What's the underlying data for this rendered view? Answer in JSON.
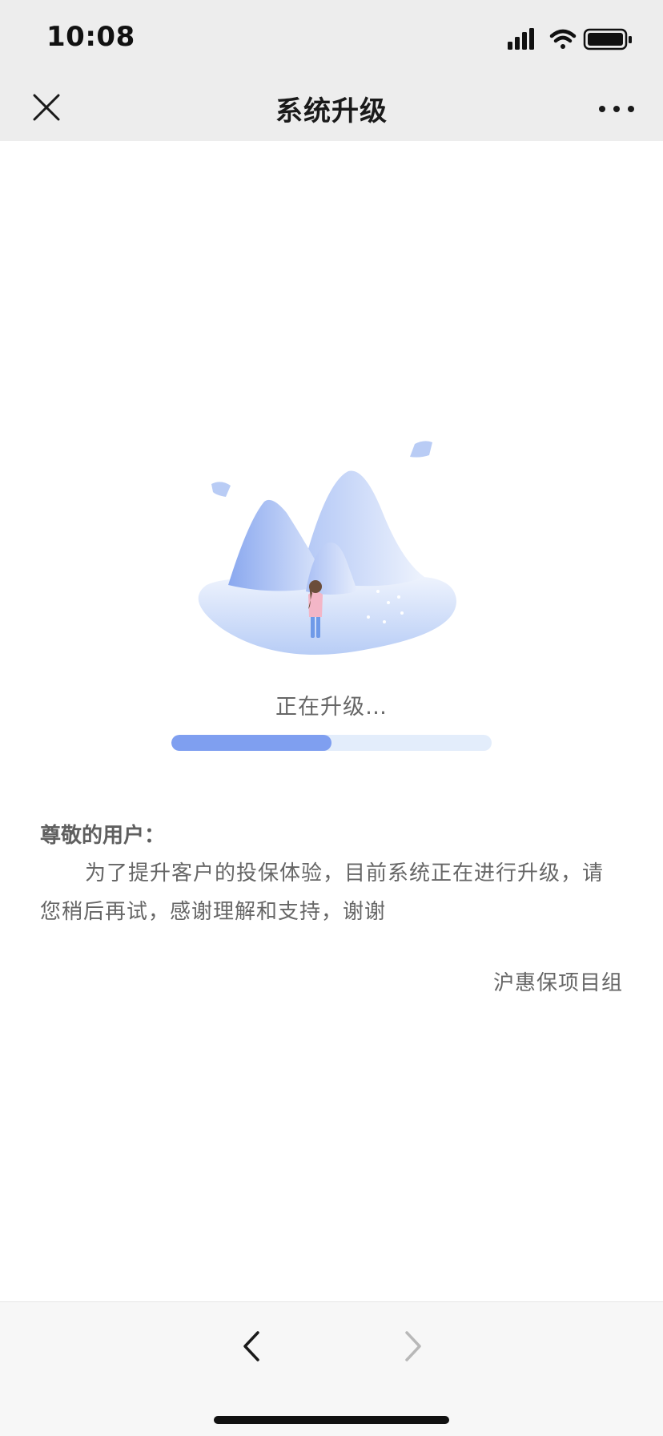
{
  "status_bar": {
    "time": "10:08",
    "icons": [
      "signal-icon",
      "wifi-icon",
      "battery-icon"
    ]
  },
  "nav_bar": {
    "title": "系统升级",
    "close_icon": "close-icon",
    "more_icon": "more-icon"
  },
  "upgrade": {
    "status_text": "正在升级…",
    "progress": 0.5
  },
  "notice": {
    "greeting": "尊敬的用户：",
    "message": "为了提升客户的投保体验，目前系统正在进行升级，请您稍后再试，感谢理解和支持，谢谢",
    "signature": "沪惠保项目组"
  },
  "bottom_nav": {
    "back_icon": "chevron-left-icon",
    "forward_icon": "chevron-right-icon",
    "forward_enabled": false
  },
  "colors": {
    "progress_fill": "#7f9ff0",
    "progress_track": "#e3edfb",
    "header_bg": "#ededed",
    "text_gray": "#666666"
  }
}
